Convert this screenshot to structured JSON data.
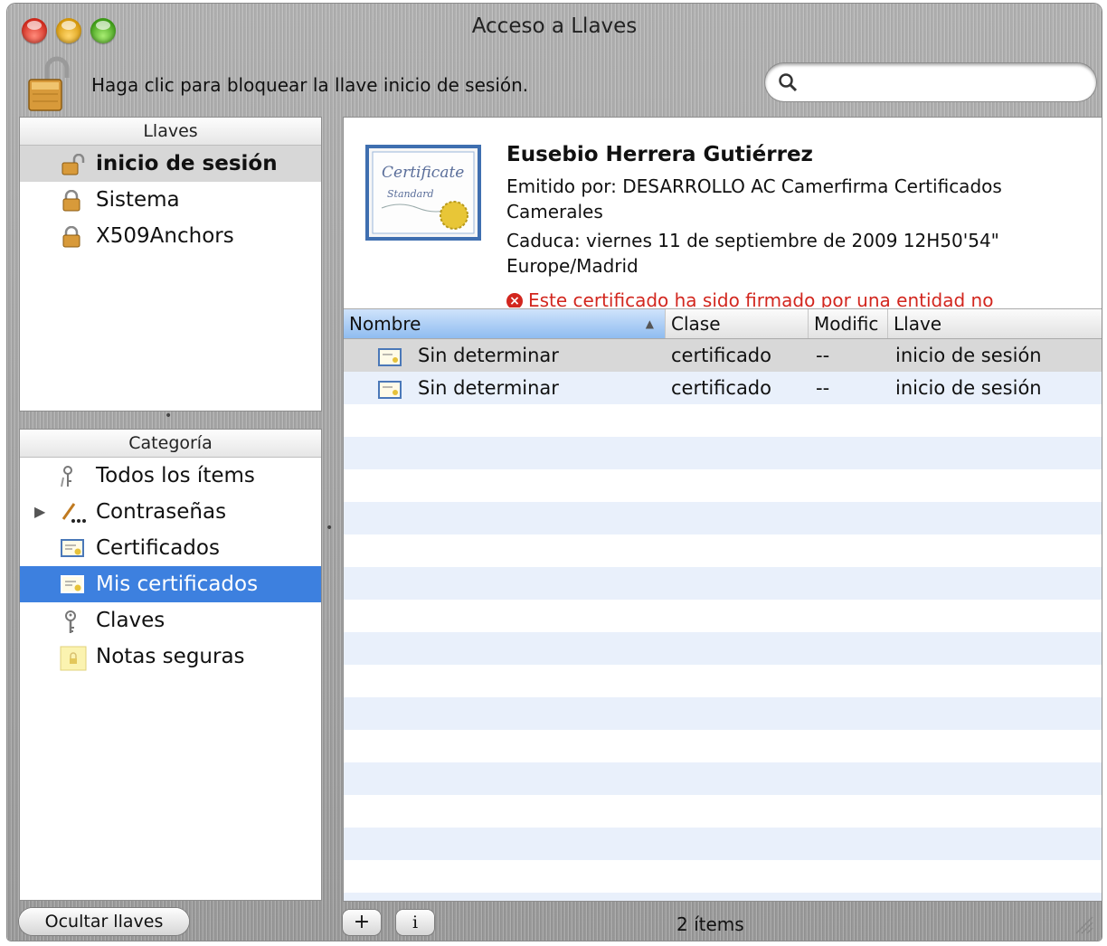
{
  "window": {
    "title": "Acceso a Llaves"
  },
  "toolbar": {
    "lock_message": "Haga clic para bloquear la llave inicio de sesión.",
    "search_placeholder": ""
  },
  "keychains": {
    "header": "Llaves",
    "items": [
      {
        "label": "inicio de sesión",
        "icon": "unlocked-padlock-icon",
        "selected": true
      },
      {
        "label": "Sistema",
        "icon": "padlock-icon"
      },
      {
        "label": "X509Anchors",
        "icon": "padlock-icon"
      }
    ]
  },
  "category": {
    "header": "Categoría",
    "items": [
      {
        "label": "Todos los ítems",
        "icon": "keys-icon"
      },
      {
        "label": "Contraseñas",
        "icon": "password-icon",
        "expandable": true
      },
      {
        "label": "Certificados",
        "icon": "certificate-icon"
      },
      {
        "label": "Mis certificados",
        "icon": "my-certificate-icon",
        "selected": true
      },
      {
        "label": "Claves",
        "icon": "key-icon"
      },
      {
        "label": "Notas seguras",
        "icon": "secure-note-icon"
      }
    ]
  },
  "detail": {
    "name": "Eusebio Herrera Gutiérrez",
    "issued_by": "Emitido por: DESARROLLO AC Camerfirma Certificados Camerales",
    "expires": "Caduca: viernes 11 de septiembre de 2009 12H50'54\" Europe/Madrid",
    "warning": "Este certificado ha sido firmado por una entidad no"
  },
  "table": {
    "columns": [
      "Nombre",
      "Clase",
      "Modific",
      "Llave"
    ],
    "sorted_column": "Nombre",
    "rows": [
      {
        "name": "Sin determinar",
        "class": "certificado",
        "modified": "--",
        "keychain": "inicio de sesión",
        "selected": true
      },
      {
        "name": "Sin determinar",
        "class": "certificado",
        "modified": "--",
        "keychain": "inicio de sesión"
      }
    ]
  },
  "footer": {
    "hide_button": "Ocultar llaves",
    "add_button": "+",
    "info_button": "i",
    "item_count": "2 ítems"
  },
  "colors": {
    "selection_blue": "#3d80df",
    "warning_red": "#d2261e"
  }
}
